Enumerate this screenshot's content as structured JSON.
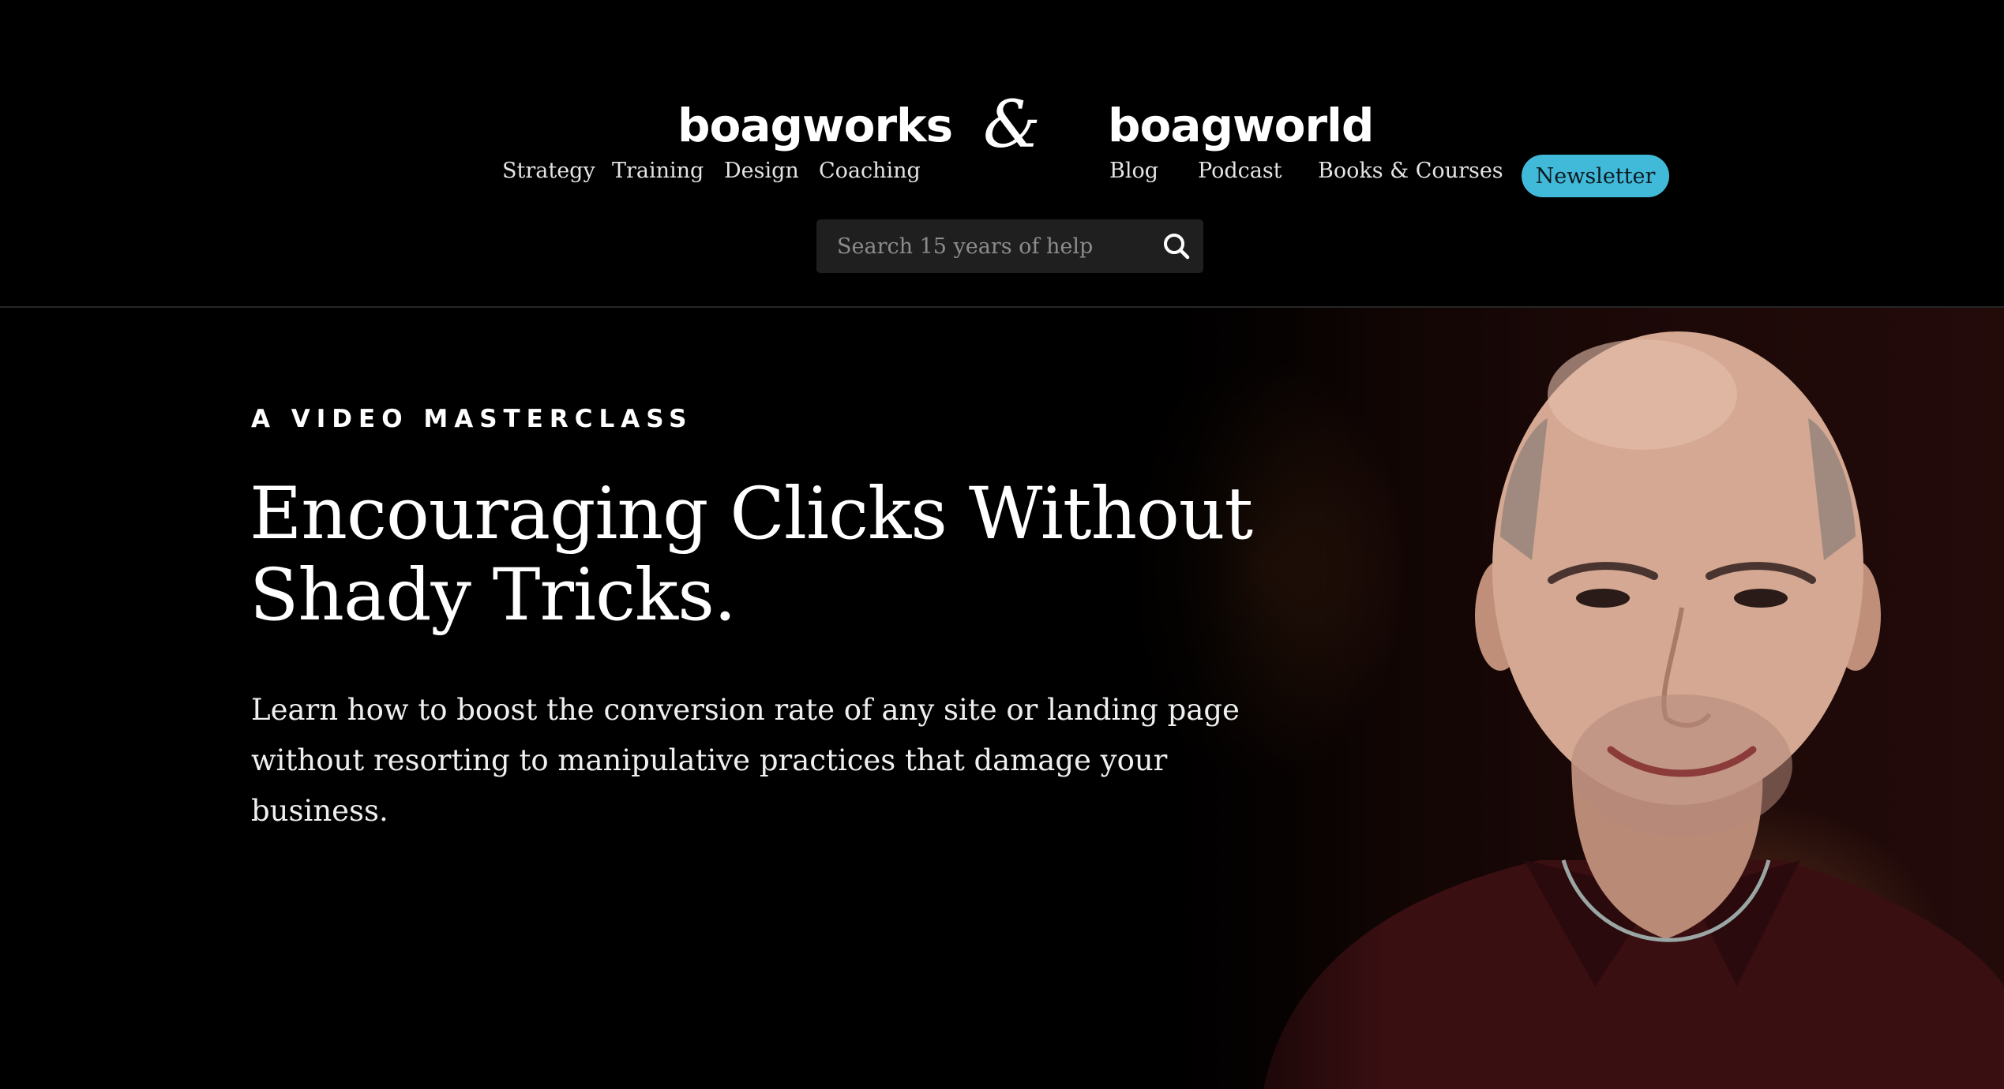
{
  "header": {
    "logo_left": "boagworks",
    "ampersand": "&",
    "logo_right": "boagworld",
    "nav_left": [
      {
        "label": "Strategy"
      },
      {
        "label": "Training"
      },
      {
        "label": "Design"
      },
      {
        "label": "Coaching"
      }
    ],
    "nav_right": [
      {
        "label": "Blog"
      },
      {
        "label": "Podcast"
      },
      {
        "label": "Books & Courses"
      }
    ],
    "newsletter_label": "Newsletter",
    "search": {
      "placeholder": "Search 15 years of help",
      "icon": "search-icon"
    }
  },
  "hero": {
    "eyebrow": "A VIDEO MASTERCLASS",
    "title_line1": "Encouraging Clicks Without",
    "title_line2": "Shady Tricks.",
    "subtitle_line1": "Learn how to boost the conversion rate of any site or landing page",
    "subtitle_line2": "without resorting to manipulative practices that damage your business."
  },
  "colors": {
    "background": "#000000",
    "accent": "#41b9d9",
    "search_bg": "#1f1f1f",
    "shirt": "#3a0f12"
  }
}
